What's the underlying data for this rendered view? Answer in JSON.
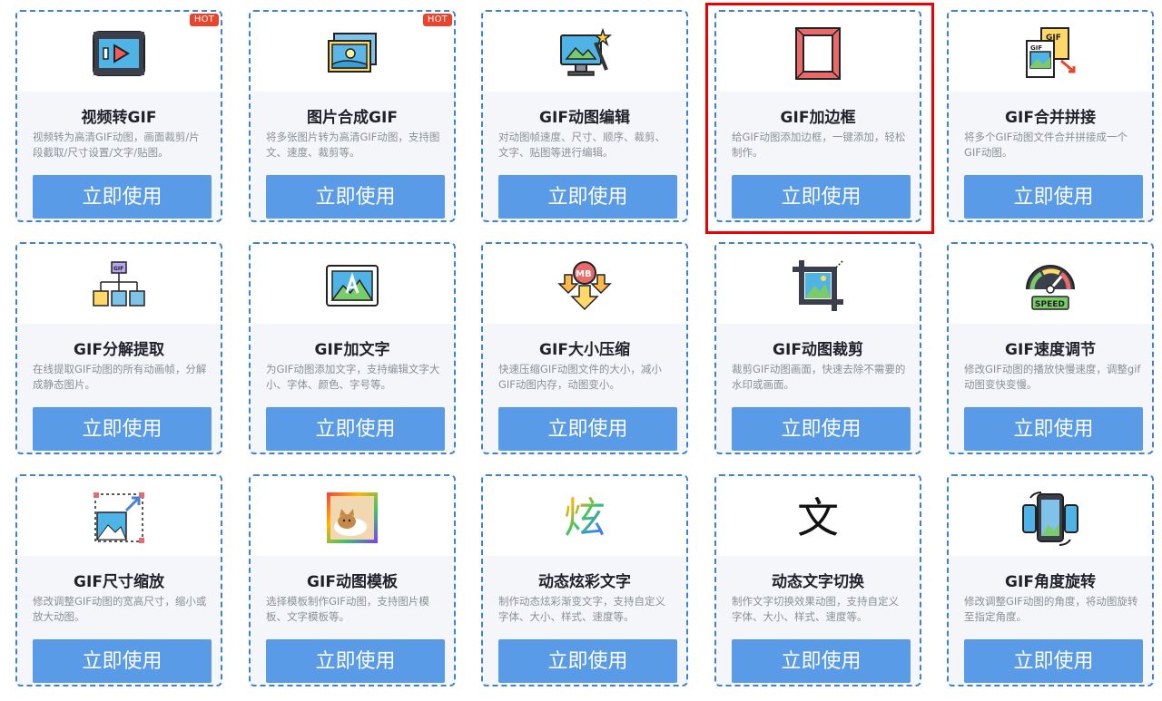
{
  "hot_label": "HOT",
  "button_label": "立即使用",
  "cards": [
    {
      "title": "视频转GIF",
      "desc": "视频转为高清GIF动图，画面裁剪/片段截取/尺寸设置/文字/贴图。",
      "hot": true,
      "icon": "video-play-icon"
    },
    {
      "title": "图片合成GIF",
      "desc": "将多张图片转为高清GIF动图，支持图文、速度、裁剪等。",
      "hot": true,
      "icon": "image-stack-icon"
    },
    {
      "title": "GIF动图编辑",
      "desc": "对动图帧速度、尺寸、顺序、裁剪、文字、贴图等进行编辑。",
      "hot": false,
      "icon": "monitor-edit-icon"
    },
    {
      "title": "GIF加边框",
      "desc": "给GIF动图添加边框，一键添加，轻松制作。",
      "hot": false,
      "icon": "frame-border-icon"
    },
    {
      "title": "GIF合并拼接",
      "desc": "将多个GIF动图文件合并拼接成一个GIF动图。",
      "hot": false,
      "icon": "merge-files-icon"
    },
    {
      "title": "GIF分解提取",
      "desc": "在线提取GIF动图的所有动画帧，分解成静态图片。",
      "hot": false,
      "icon": "hierarchy-split-icon"
    },
    {
      "title": "GIF加文字",
      "desc": "为GIF动图添加文字，支持编辑文字大小、字体、颜色、字号等。",
      "hot": false,
      "icon": "image-text-icon"
    },
    {
      "title": "GIF大小压缩",
      "desc": "快速压缩GIF动图文件的大小，减小GIF动图内存，动图变小。",
      "hot": false,
      "icon": "compress-mb-icon"
    },
    {
      "title": "GIF动图裁剪",
      "desc": "裁剪GIF动图画面，快速去除不需要的水印或画面。",
      "hot": false,
      "icon": "crop-icon"
    },
    {
      "title": "GIF速度调节",
      "desc": "修改GIF动图的播放快慢速度，调整gif动图变快变慢。",
      "hot": false,
      "icon": "speed-gauge-icon"
    },
    {
      "title": "GIF尺寸缩放",
      "desc": "修改调整GIF动图的宽高尺寸，缩小或放大动图。",
      "hot": false,
      "icon": "resize-icon"
    },
    {
      "title": "GIF动图模板",
      "desc": "选择模板制作GIF动图，支持图片模板、文字模板等。",
      "hot": false,
      "icon": "cat-template-icon"
    },
    {
      "title": "动态炫彩文字",
      "desc": "制作动态炫彩渐变文字，支持自定义字体、大小、样式、速度等。",
      "hot": false,
      "icon": "colorful-text-icon",
      "char": "炫"
    },
    {
      "title": "动态文字切换",
      "desc": "制作文字切换效果动图，支持自定义字体、大小、样式、速度等。",
      "hot": false,
      "icon": "text-switch-icon",
      "char": "文"
    },
    {
      "title": "GIF角度旋转",
      "desc": "修改调整GIF动图的角度，将动图旋转至指定角度。",
      "hot": false,
      "icon": "rotate-phone-icon"
    }
  ]
}
